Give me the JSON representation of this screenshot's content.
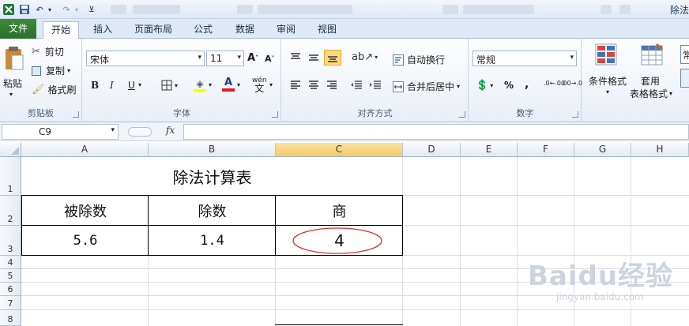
{
  "title_bar": {
    "window_title": "除法"
  },
  "ribbon_tabs": [
    {
      "label": "文件"
    },
    {
      "label": "开始"
    },
    {
      "label": "插入"
    },
    {
      "label": "页面布局"
    },
    {
      "label": "公式"
    },
    {
      "label": "数据"
    },
    {
      "label": "审阅"
    },
    {
      "label": "视图"
    }
  ],
  "clipboard": {
    "paste": "粘贴",
    "cut": "剪切",
    "copy": "复制",
    "format_painter": "格式刷",
    "group_label": "剪贴板"
  },
  "font": {
    "name": "宋体",
    "size": "11",
    "bold": "B",
    "italic": "I",
    "underline": "U",
    "wen": "wén",
    "grow": "A",
    "shrink": "A",
    "font_color_glyph": "A",
    "group_label": "字体"
  },
  "alignment": {
    "wrap_text": "自动换行",
    "merge_center": "合并后居中",
    "group_label": "对齐方式"
  },
  "number": {
    "format": "常规",
    "percent": "%",
    "comma": ",",
    "inc_decimal": ".0←.00",
    "dec_decimal": ".00→.0",
    "group_label": "数字"
  },
  "styles": {
    "conditional_format": "条件格式",
    "table_format_line1": "套用",
    "table_format_line2": "表格格式",
    "edge_label": "常"
  },
  "formula_bar": {
    "name_box": "C9",
    "fx": "fx",
    "formula": ""
  },
  "columns": [
    "A",
    "B",
    "C",
    "D",
    "E",
    "F",
    "G",
    "H"
  ],
  "rows": [
    "1",
    "2",
    "3",
    "4",
    "5",
    "6",
    "7",
    "8"
  ],
  "cells": {
    "title": "除法计算表",
    "header_a": "被除数",
    "header_b": "除数",
    "header_c": "商",
    "a3": "5.6",
    "b3": "1.4",
    "c3": "4"
  },
  "colors": {
    "file_tab": "#2b6e2a",
    "selected_header": "#f4c96a",
    "circle": "#d9302c",
    "grid": "#dadcdd"
  },
  "watermark": {
    "brand": "Baidu经验",
    "url": "jingyan.baidu.com"
  }
}
